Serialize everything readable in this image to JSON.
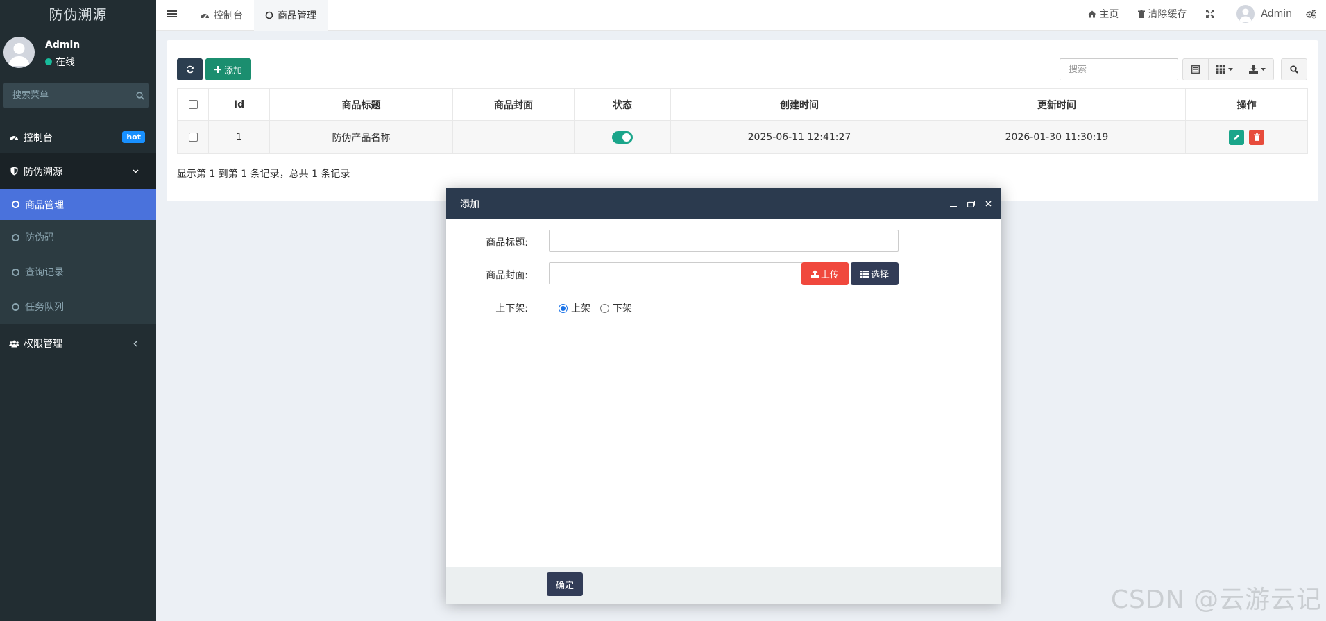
{
  "app": {
    "logo": "防伪溯源"
  },
  "user": {
    "name": "Admin",
    "status": "在线"
  },
  "sidebar": {
    "search_placeholder": "搜索菜单",
    "items": [
      {
        "label": "控制台",
        "icon": "dashboard-icon",
        "badge": "hot"
      },
      {
        "label": "防伪溯源",
        "icon": "shield-icon"
      },
      {
        "label": "权限管理",
        "icon": "users-icon"
      }
    ],
    "subitems": [
      {
        "label": "商品管理"
      },
      {
        "label": "防伪码"
      },
      {
        "label": "查询记录"
      },
      {
        "label": "任务队列"
      }
    ]
  },
  "header": {
    "tabs": [
      {
        "label": "控制台",
        "icon": "dashboard-icon"
      },
      {
        "label": "商品管理",
        "icon": "circle-icon"
      }
    ],
    "home": "主页",
    "clear_cache": "清除缓存",
    "user": "Admin"
  },
  "toolbar": {
    "add_label": "添加",
    "search_placeholder": "搜索"
  },
  "table": {
    "columns": [
      "Id",
      "商品标题",
      "商品封面",
      "状态",
      "创建时间",
      "更新时间",
      "操作"
    ],
    "rows": [
      {
        "id": "1",
        "title": "防伪产品名称",
        "cover": "",
        "status": true,
        "created": "2025-06-11 12:41:27",
        "updated": "2026-01-30 11:30:19"
      }
    ],
    "summary": "显示第 1 到第 1 条记录，总共 1 条记录"
  },
  "modal": {
    "title": "添加",
    "fields": {
      "title_label": "商品标题:",
      "title_value": "",
      "cover_label": "商品封面:",
      "cover_value": "",
      "upload_label": "上传",
      "select_label": "选择",
      "status_label": "上下架:",
      "options": [
        "上架",
        "下架"
      ],
      "selected": "上架"
    },
    "confirm_label": "确定"
  },
  "watermark": "CSDN @云游云记",
  "colors": {
    "sidebar_bg": "#222d32",
    "active_item": "#4a72dc",
    "modal_header": "#2b3a4e",
    "success": "#1aa58a",
    "danger": "#f0483d"
  }
}
